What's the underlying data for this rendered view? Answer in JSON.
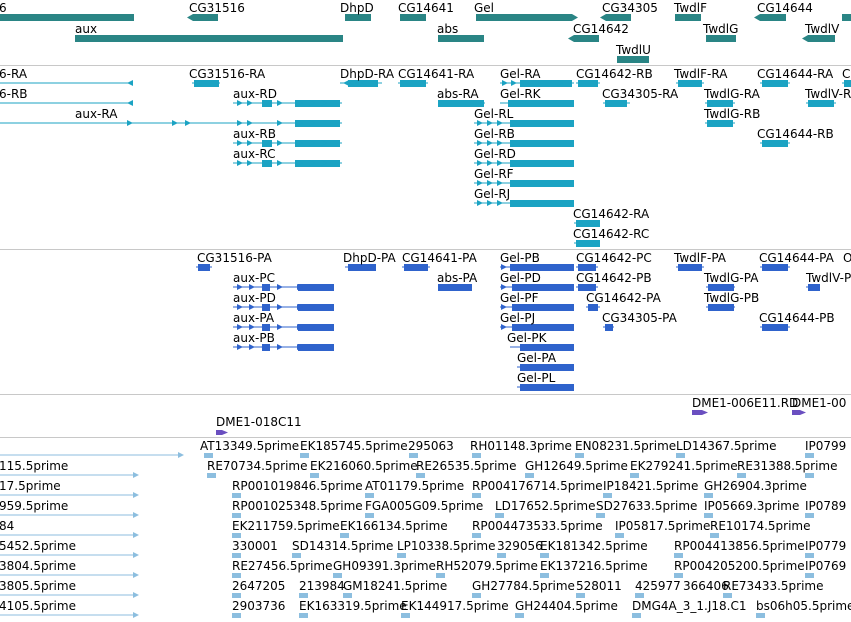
{
  "colors": {
    "gene": "#2a8585",
    "transcript": "#1ba3c3",
    "protein": "#2f63cc",
    "clone": "#6a4fc0",
    "est": "#8cbedf",
    "separator": "#c8c8c8"
  },
  "tracks": {
    "genes": {
      "labels": [
        "6",
        "CG31516",
        "DhpD",
        "CG14641",
        "Gel",
        "CG34305",
        "TwdlF",
        "CG14644",
        "aux",
        "abs",
        "CG14642",
        "TwdlG",
        "TwdlV",
        "TwdlU"
      ]
    },
    "transcripts": {
      "labels": [
        "6-RA",
        "CG31516-RA",
        "DhpD-RA",
        "CG14641-RA",
        "Gel-RA",
        "CG14642-RB",
        "TwdlF-RA",
        "CG14644-RA",
        "Cl",
        "6-RB",
        "aux-RD",
        "abs-RA",
        "Gel-RK",
        "CG34305-RA",
        "TwdlG-RA",
        "TwdlV-R",
        "aux-RA",
        "Gel-RL",
        "TwdlG-RB",
        "aux-RB",
        "Gel-RB",
        "CG14644-RB",
        "aux-RC",
        "Gel-RD",
        "Gel-RF",
        "Gel-RJ",
        "CG14642-RA",
        "CG14642-RC"
      ]
    },
    "proteins": {
      "labels": [
        "CG31516-PA",
        "DhpD-PA",
        "CG14641-PA",
        "Gel-PB",
        "CG14642-PC",
        "TwdlF-PA",
        "CG14644-PA",
        "O",
        "aux-PC",
        "abs-PA",
        "Gel-PD",
        "CG14642-PB",
        "TwdlG-PA",
        "TwdlV-P",
        "aux-PD",
        "Gel-PF",
        "CG14642-PA",
        "TwdlG-PB",
        "aux-PA",
        "Gel-PJ",
        "CG34305-PA",
        "CG14644-PB",
        "aux-PB",
        "Gel-PK",
        "Gel-PA",
        "Gel-PL"
      ]
    },
    "clones": {
      "labels": [
        "DME1-006E11.RD",
        "DME1-00",
        "DME1-018C11"
      ]
    },
    "ests": {
      "labels": [
        "AT13349.5prime",
        "EK185745.5prime",
        "295063",
        "RH01148.3prime",
        "EN08231.5prime",
        "LD14367.5prime",
        "IP0799",
        "115.5prime",
        "RE70734.5prime",
        "EK216060.5prime",
        "RE26535.5prime",
        "GH12649.5prime",
        "EK279241.5prime",
        "RE31388.5prime",
        "17.5prime",
        "RP001019846.5prime",
        "AT01179.5prime",
        "RP004176714.5prime",
        "IP18421.5prime",
        "GH26904.3prime",
        "959.5prime",
        "RP001025348.5prime",
        "FGA005G09.5prime",
        "LD17652.5prime",
        "SD27633.5prime",
        "IP05669.3prime",
        "IP0789",
        "84",
        "EK211759.5prime",
        "EK166134.5prime",
        "RP004473533.5prime",
        "IP05817.5prime",
        "RE10174.5prime",
        "5452.5prime",
        "330001",
        "SD14314.5prime",
        "LP10338.5prime",
        "329056",
        "EK181342.5prime",
        "RP004413856.5prime",
        "IP0779",
        "3804.5prime",
        "RE27456.5prime",
        "GH09391.3prime",
        "RH52079.5prime",
        "EK137216.5prime",
        "RP004205200.5prime",
        "IP0769",
        "3805.5prime",
        "2647205",
        "213984",
        "GM18241.5prime",
        "GH27784.5prime",
        "528011",
        "425977",
        "366406",
        "RE73433.5prime",
        "4105.5prime",
        "2903736",
        "EK163319.5prime",
        "EK144917.5prime",
        "GH24404.5prime",
        "DMG4A_3_1.J18.C1",
        "bs06h05.5prime"
      ]
    }
  }
}
